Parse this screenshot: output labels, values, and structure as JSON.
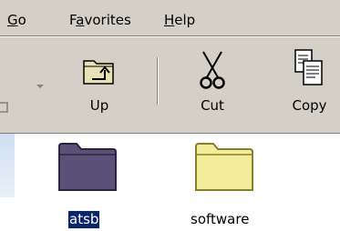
{
  "menubar": {
    "items": [
      {
        "label": "Go",
        "underline": "G",
        "rest": "o"
      },
      {
        "label": "Favorites",
        "pre": "F",
        "underline": "a",
        "rest": "vorites"
      },
      {
        "label": "Help",
        "underline": "H",
        "rest": "elp"
      }
    ]
  },
  "toolbar": {
    "up_label": "Up",
    "cut_label": "Cut",
    "copy_label": "Copy",
    "icons": [
      "back-icon",
      "dropdown-arrow-icon",
      "folder-up-icon",
      "scissors-icon",
      "copy-icon"
    ]
  },
  "files": [
    {
      "name": "atsb",
      "selected": true,
      "icon": "folder-icon",
      "color": "#5a5078"
    },
    {
      "name": "software",
      "selected": false,
      "icon": "folder-icon",
      "color": "#f3ec9a"
    }
  ],
  "colors": {
    "chrome": "#d4d0c8",
    "selection": "#0a246a"
  }
}
